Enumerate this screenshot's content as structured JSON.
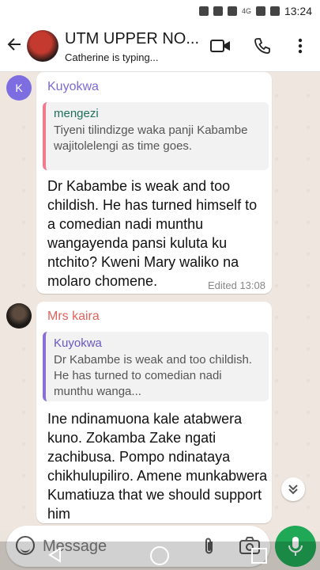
{
  "status_bar": {
    "time": "13:24",
    "network_label": "4G"
  },
  "header": {
    "title": "UTM UPPER NO...",
    "subtitle": "Catherine is typing..."
  },
  "messages": [
    {
      "avatar_initial": "K",
      "sender": "Kuyokwa",
      "sender_color": "#7b6bd6",
      "quote": {
        "author": "mengezi",
        "text": "Tiyeni tilindizge waka panji Kabambe wajitolelengi as time goes."
      },
      "body": "Dr Kabambe is weak and too childish. He has turned himself to a comedian nadi munthu wangayenda pansi kuluta ku ntchito? Kweni Mary waliko na molaro chomene.",
      "meta": "Edited 13:08"
    },
    {
      "sender": "Mrs kaira",
      "sender_color": "#e0625c",
      "quote": {
        "author": "Kuyokwa",
        "text": "Dr Kabambe is weak and too childish. He has turned to comedian nadi munthu wanga..."
      },
      "body": "Ine ndinamuona kale atabwera kuno. Zokamba Zake ngati zachibusa. Pompo ndinataya chikhulupiliro. Amene munkabwera Kumatiuza that we should support him"
    }
  ],
  "composer": {
    "placeholder": "Message"
  },
  "colors": {
    "accent_green": "#1fa855",
    "chat_background": "#efe7df"
  }
}
